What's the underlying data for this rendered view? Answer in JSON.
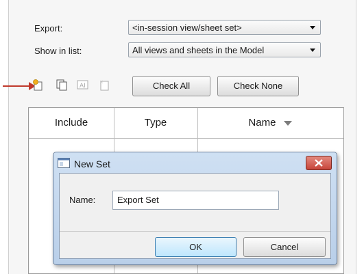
{
  "export": {
    "label": "Export:",
    "value": "<in-session view/sheet set>"
  },
  "show_in_list": {
    "label": "Show in list:",
    "value": "All views and sheets in the Model"
  },
  "toolbar": {
    "icons": [
      "new-set-icon",
      "duplicate-set-icon",
      "rename-set-icon",
      "delete-set-icon"
    ],
    "check_all": "Check All",
    "check_none": "Check None"
  },
  "table": {
    "columns": [
      "Include",
      "Type",
      "Name"
    ]
  },
  "dialog": {
    "title": "New Set",
    "name_label": "Name:",
    "name_value": "Export Set",
    "ok": "OK",
    "cancel": "Cancel"
  },
  "colors": {
    "pointer_arrow": "#c0392b",
    "close_button": "#c7453a"
  }
}
